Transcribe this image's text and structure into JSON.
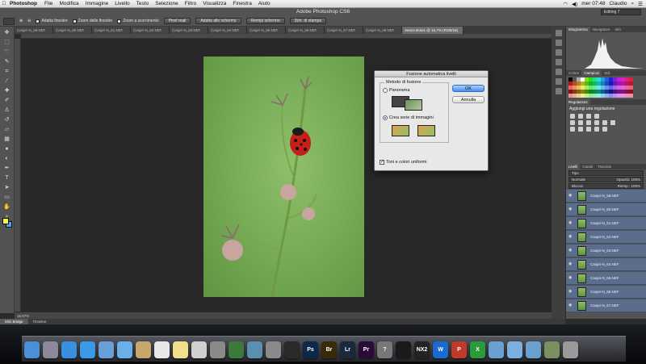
{
  "menubar": {
    "app": "Photoshop",
    "items": [
      "File",
      "Modifica",
      "Immagine",
      "Livello",
      "Testo",
      "Selezione",
      "Filtro",
      "Visualizza",
      "Finestra",
      "Aiuto"
    ],
    "time": "mer 07:48",
    "user": "Claudio"
  },
  "window": {
    "title": "Adobe Photoshop CS6",
    "workspace": "Editing 7"
  },
  "options": {
    "checkbox_1": "Adatta finestre",
    "checkbox_2": "Zoom delle finestre",
    "checkbox_3": "Zoom a scorrimento",
    "btn_1": "Pixel reali",
    "btn_2": "Adatta allo schermo",
    "btn_3": "Riempi schermo",
    "btn_4": "Dim. di stampa"
  },
  "tabs": [
    "Caspri-N_59.NEF",
    "Caspri-N_60.NEF",
    "Caspri-N_61.NEF",
    "Caspri-N_62.NEF",
    "Caspri-N_63.NEF",
    "Caspri-N_64.NEF",
    "Caspri-N_65.NEF",
    "Caspri-N_66.NEF",
    "Caspri-N_67.NEF",
    "Caspri-N_68.NEF",
    "Senza titolo1 @ 16,7% (RGB/16)"
  ],
  "status": {
    "zoom": "16,67%"
  },
  "bottom_tabs": [
    "Mini Bridge",
    "Timeline"
  ],
  "panels": {
    "histogram_tabs": [
      "Istogramma",
      "Navigatore",
      "Info"
    ],
    "color_tabs": [
      "Colore",
      "Campioni",
      "Stili"
    ],
    "adjust_tab": "Regolazioni",
    "adjust_title": "Aggiungi una regolazione",
    "layers_tabs": [
      "Livelli",
      "Canali",
      "Tracciati"
    ],
    "kind": "Tipo",
    "blend": "Normale",
    "opacity_label": "Opacità:",
    "opacity": "100%",
    "lock_label": "Blocca:",
    "fill_label": "Riemp.:",
    "fill": "100%",
    "layers": [
      "Caspri-N_59.NEF",
      "Caspri-N_60.NEF",
      "Caspri-N_61.NEF",
      "Caspri-N_62.NEF",
      "Caspri-N_63.NEF",
      "Caspri-N_64.NEF",
      "Caspri-N_65.NEF",
      "Caspri-N_66.NEF",
      "Caspri-N_67.NEF"
    ]
  },
  "dialog": {
    "title": "Fusione automatica livelli",
    "group": "Metodo di fusione",
    "option_1": "Panorama",
    "option_2": "Crea serie di immagini",
    "checkbox": "Toni e colori uniformi",
    "ok": "OK",
    "cancel": "Annulla"
  },
  "dock": [
    "Finder",
    "Launchpad",
    "App Store",
    "Safari",
    "Mail",
    "iTunes",
    "Contatti",
    "Calendario",
    "Note",
    "Anteprima",
    "Utility",
    "Time Machine",
    "iPhoto",
    "Preferenze",
    "Lettore DVD",
    "Ps",
    "Br",
    "Lr",
    "Pr",
    "Aiuto",
    "Lightroom",
    "NX2",
    "W",
    "P",
    "X",
    "Cartella",
    "Documenti",
    "Download",
    "Utility",
    "Cestino"
  ]
}
